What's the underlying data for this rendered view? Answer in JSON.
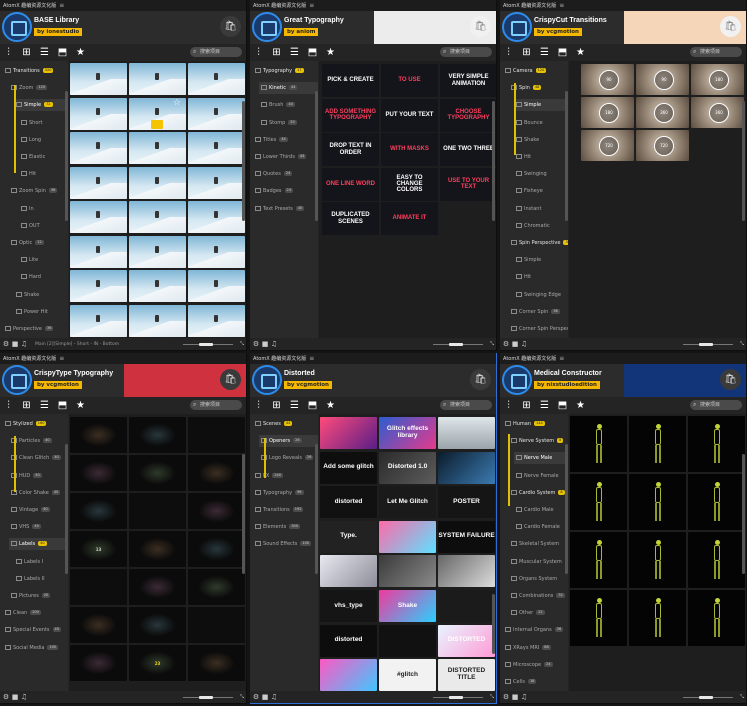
{
  "window_title": "AtomX 趣编资源文化版",
  "search_placeholder": "搜索项目",
  "panels": [
    {
      "pack_title": "BASE Library",
      "author": "by ionestudio",
      "footer_path": "Main [2][Simple] - Short - IN - Bottom",
      "sidebar": [
        {
          "label": "Transitions",
          "count": "320",
          "hl": true
        },
        {
          "label": "Zoom",
          "count": "120"
        },
        {
          "label": "Simple",
          "count": "72",
          "hl": true
        },
        {
          "label": "Short",
          "count": ""
        },
        {
          "label": "Long",
          "count": ""
        },
        {
          "label": "Elastic",
          "count": ""
        },
        {
          "label": "Hit",
          "count": ""
        },
        {
          "label": "Zoom Spin",
          "count": "36"
        },
        {
          "label": "In",
          "count": ""
        },
        {
          "label": "OUT",
          "count": ""
        },
        {
          "label": "Optic",
          "count": "12"
        },
        {
          "label": "Lite",
          "count": ""
        },
        {
          "label": "Hard",
          "count": ""
        },
        {
          "label": "Shake",
          "count": ""
        },
        {
          "label": "Power Hit",
          "count": ""
        },
        {
          "label": "Perspective",
          "count": "36"
        }
      ]
    },
    {
      "pack_title": "Great Typography",
      "author": "by aniom",
      "sidebar": [
        {
          "label": "Typography",
          "count": "17",
          "hl": true
        },
        {
          "label": "Kinetic",
          "count": "44"
        },
        {
          "label": "Brush",
          "count": "44"
        },
        {
          "label": "Stomp",
          "count": "20"
        },
        {
          "label": "Titles",
          "count": "44"
        },
        {
          "label": "Lower Thirds",
          "count": "44"
        },
        {
          "label": "Quotes",
          "count": "24"
        },
        {
          "label": "Badges",
          "count": "24"
        },
        {
          "label": "Text Presets",
          "count": "40"
        }
      ],
      "tiles": [
        "PICK & CREATE",
        "TO USE",
        "VERY SIMPLE ANIMATION",
        "ADD SOMETHING TYPOGRAPHY",
        "PUT YOUR TEXT",
        "CHOOSE TYPOGRAPHY",
        "DROP TEXT IN ORDER",
        "WITH MASKS",
        "ONE TWO THREE",
        "ONE LINE WORD",
        "EASY TO CHANGE COLORS",
        "USE TO YOUR TEXT",
        "DUPLICATED SCENES",
        "ANIMATE IT"
      ]
    },
    {
      "pack_title": "CrispyCut Transitions",
      "author": "by vcgmotion",
      "sidebar": [
        {
          "label": "Camera",
          "count": "120",
          "hl": true
        },
        {
          "label": "Spin",
          "count": "48",
          "hl": true
        },
        {
          "label": "Simple",
          "count": ""
        },
        {
          "label": "Bounce",
          "count": ""
        },
        {
          "label": "Shake",
          "count": ""
        },
        {
          "label": "Hit",
          "count": ""
        },
        {
          "label": "Swinging",
          "count": ""
        },
        {
          "label": "Fisheye",
          "count": ""
        },
        {
          "label": "Instant",
          "count": ""
        },
        {
          "label": "Chromatic",
          "count": ""
        },
        {
          "label": "Spin Perspective",
          "count": "36",
          "hl": true
        },
        {
          "label": "Simple",
          "count": ""
        },
        {
          "label": "Hit",
          "count": ""
        },
        {
          "label": "Swinging Edge",
          "count": ""
        },
        {
          "label": "Corner Spin",
          "count": "36"
        },
        {
          "label": "Corner Spin Perspect",
          "count": ""
        }
      ],
      "tiles": [
        "90",
        "90",
        "180",
        "180",
        "360",
        "360",
        "720",
        "720"
      ]
    },
    {
      "pack_title": "CrispyType Typography",
      "author": "by vcgmotion",
      "sidebar": [
        {
          "label": "Stylized",
          "count": "160",
          "hl": true
        },
        {
          "label": "Particles",
          "count": "40"
        },
        {
          "label": "Clean Glitch",
          "count": "40"
        },
        {
          "label": "HUD",
          "count": "40"
        },
        {
          "label": "Color Shake",
          "count": "40"
        },
        {
          "label": "Vintage",
          "count": "40"
        },
        {
          "label": "VHS",
          "count": "40"
        },
        {
          "label": "Labels",
          "count": "40",
          "hl": true
        },
        {
          "label": "Labels I",
          "count": ""
        },
        {
          "label": "Labels II",
          "count": ""
        },
        {
          "label": "Pictures",
          "count": "20"
        },
        {
          "label": "Clean",
          "count": "200"
        },
        {
          "label": "Special Events",
          "count": "40"
        },
        {
          "label": "Social Media",
          "count": "100"
        }
      ],
      "tiles": [
        "",
        "",
        "",
        "",
        "",
        "",
        "",
        "",
        "",
        "13",
        "",
        "",
        "",
        "",
        "",
        "",
        "",
        "",
        "",
        "23",
        ""
      ]
    },
    {
      "pack_title": "Distorted",
      "author": "by vcgmotion",
      "sidebar": [
        {
          "label": "Scenes",
          "count": "44",
          "hl": true
        },
        {
          "label": "Openers",
          "count": "26"
        },
        {
          "label": "Logo Reveals",
          "count": "26"
        },
        {
          "label": "FX",
          "count": "240"
        },
        {
          "label": "Typography",
          "count": "96"
        },
        {
          "label": "Transitions",
          "count": "192"
        },
        {
          "label": "Elements",
          "count": "300"
        },
        {
          "label": "Sound Effects",
          "count": "100"
        }
      ],
      "tiles": [
        "",
        "Glitch effects library",
        "",
        "Add some glitch",
        "Distorted 1.0",
        "",
        "distorted",
        "Let Me Glitch",
        "POSTER",
        "Type.",
        "",
        "SYSTEM FAILURE",
        "",
        "",
        "",
        "vhs_type",
        "Shake",
        "",
        "distorted",
        "",
        "DISTORTED",
        "",
        "#glitch",
        "DISTORTED TITLE"
      ]
    },
    {
      "pack_title": "Medical Constructor",
      "author": "by nixstudioedition",
      "sidebar": [
        {
          "label": "Human",
          "count": "144",
          "hl": true
        },
        {
          "label": "Nerve System",
          "count": "8",
          "hl": true
        },
        {
          "label": "Nerve Male",
          "count": ""
        },
        {
          "label": "Nerve Female",
          "count": ""
        },
        {
          "label": "Cardio System",
          "count": "8",
          "hl": true
        },
        {
          "label": "Cardio Male",
          "count": ""
        },
        {
          "label": "Cardio Female",
          "count": ""
        },
        {
          "label": "Skeletal System",
          "count": ""
        },
        {
          "label": "Muscular System",
          "count": ""
        },
        {
          "label": "Organs System",
          "count": ""
        },
        {
          "label": "Combinations",
          "count": "32"
        },
        {
          "label": "Other",
          "count": "22"
        },
        {
          "label": "Internal Organs",
          "count": "36"
        },
        {
          "label": "XRays MRI",
          "count": "88"
        },
        {
          "label": "Microscope",
          "count": "24"
        },
        {
          "label": "Cells",
          "count": "18"
        }
      ]
    }
  ],
  "colors": {
    "accent_yellow": "#e8c200",
    "selection_blue": "#2d6fd6",
    "banner_red": "#d0313f",
    "banner_navy": "#12357a",
    "banner_peach": "#f5d6b8"
  }
}
